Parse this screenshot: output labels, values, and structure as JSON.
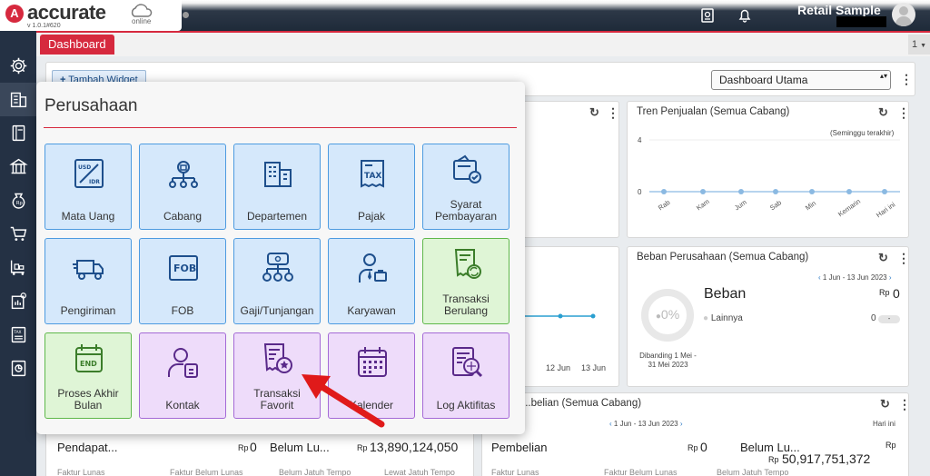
{
  "app": {
    "logo_text": "accurate",
    "logo_sub": "online",
    "version": "v 1.0.1#620",
    "company_name": "Retail Sample"
  },
  "tabs": {
    "active": "Dashboard",
    "count": "1"
  },
  "toolbar": {
    "add_widget": "Tambah Widget",
    "dashboard_select": "Dashboard Utama"
  },
  "sidebar": {
    "icons": [
      "gear-icon",
      "company-icon",
      "book-icon",
      "bank-icon",
      "money-bag-icon",
      "cart-icon",
      "warehouse-cart-icon",
      "building-chart-icon",
      "tax-icon",
      "report-icon"
    ]
  },
  "widgets": {
    "tren": {
      "title": "Tren Penjualan (Semua Cabang)",
      "period": "(Seminggu terakhir)",
      "y_max": "4",
      "y_min": "0",
      "days": [
        "Rab",
        "Kam",
        "Jum",
        "Sab",
        "Min",
        "Kemarin",
        "Hari ini"
      ]
    },
    "beban": {
      "title": "Beban Perusahaan (Semua Cabang)",
      "range": "1 Jun - 13 Jun 2023",
      "percent": "0%",
      "label": "Beban",
      "currency": "Rp",
      "amount": "0",
      "other_label": "Lainnya",
      "other_amount": "0",
      "compare": "Dibanding 1 Mei - 31 Mei 2023"
    },
    "mid_left": {
      "ticks": [
        "12 Jun",
        "13 Jun"
      ]
    },
    "bottom_left": {
      "label1": "Pendapat...",
      "cur1": "Rp",
      "val1": "0",
      "label2": "Belum Lu...",
      "cur2": "Rp",
      "val2": "13,890,124,050",
      "foot1": "Faktur Lunas",
      "foot2": "Faktur Belum Lunas",
      "foot3": "Belum Jatuh Tempo",
      "foot4": "Lewat Jatuh Tempo"
    },
    "pembelian": {
      "title": "...belian (Semua Cabang)",
      "range": "1 Jun - 13 Jun 2023",
      "today": "Hari ini",
      "label1": "Pembelian",
      "cur1": "Rp",
      "val1": "0",
      "label2": "Belum Lu...",
      "cur2": "Rp",
      "cur3": "Rp",
      "val2": "50,917,751,372",
      "foot1": "Faktur Lunas",
      "foot2": "Faktur Belum Lunas",
      "foot3": "Belum Jatuh Tempo"
    }
  },
  "overlay": {
    "title": "Perusahaan",
    "tiles": [
      {
        "label": "Mata Uang",
        "icon": "currency-exchange-icon",
        "color": "blue"
      },
      {
        "label": "Cabang",
        "icon": "branch-icon",
        "color": "blue"
      },
      {
        "label": "Departemen",
        "icon": "buildings-icon",
        "color": "blue"
      },
      {
        "label": "Pajak",
        "icon": "tax-receipt-icon",
        "color": "blue"
      },
      {
        "label": "Syarat Pembayaran",
        "icon": "payment-terms-icon",
        "color": "blue"
      },
      {
        "label": "Pengiriman",
        "icon": "delivery-truck-icon",
        "color": "blue"
      },
      {
        "label": "FOB",
        "icon": "fob-icon",
        "color": "blue"
      },
      {
        "label": "Gaji/Tunjangan",
        "icon": "salary-icon",
        "color": "blue"
      },
      {
        "label": "Karyawan",
        "icon": "employee-icon",
        "color": "blue"
      },
      {
        "label": "Transaksi Berulang",
        "icon": "recurring-transaction-icon",
        "color": "green"
      },
      {
        "label": "Proses Akhir Bulan",
        "icon": "month-end-icon",
        "color": "green"
      },
      {
        "label": "Kontak",
        "icon": "contact-icon",
        "color": "purple"
      },
      {
        "label": "Transaksi Favorit",
        "icon": "favorite-transaction-icon",
        "color": "purple"
      },
      {
        "label": "Kalender",
        "icon": "calendar-icon",
        "color": "purple"
      },
      {
        "label": "Log Aktifitas",
        "icon": "activity-log-icon",
        "color": "purple"
      }
    ]
  }
}
